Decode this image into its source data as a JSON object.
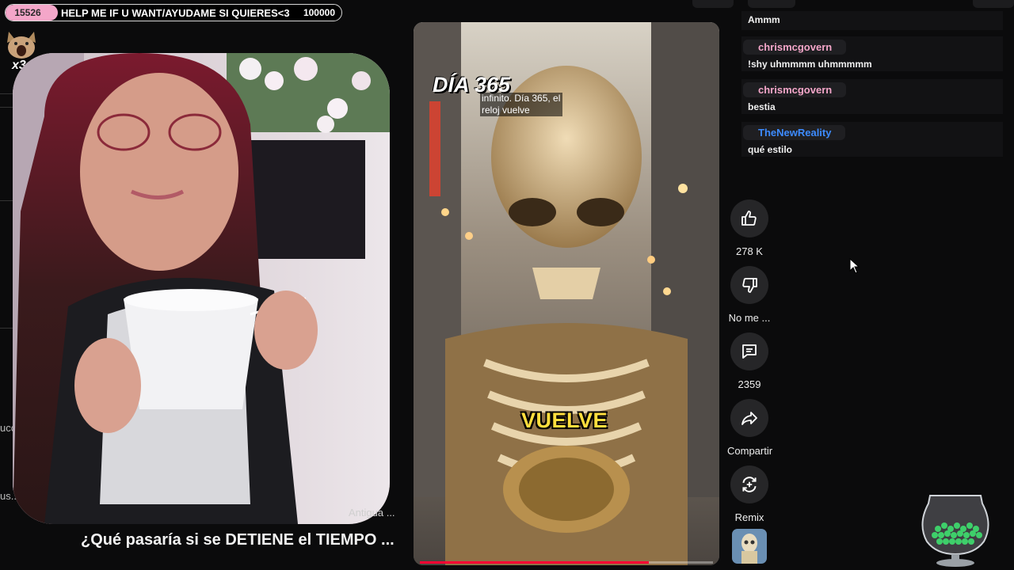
{
  "goal": {
    "current": "15526",
    "text": "HELP ME IF U WANT/AYUDAME SI QUIERES<3",
    "target": "100000",
    "progress_fraction": 0.155,
    "fill_color": "#f4a6c9"
  },
  "emote": {
    "icon": "cat-emote-icon",
    "multiplier": "x3"
  },
  "left_edge": {
    "label_1": "ucc",
    "label_2": "us..."
  },
  "stream": {
    "antigua_label": "Antigua ...",
    "video_title": "¿Qué pasaría si se DETIENE el TIEMPO ..."
  },
  "short": {
    "day_label": "DÍA 365",
    "caption_small": "infinito. Día 365, el reloj vuelve",
    "word_overlay": "VUELVE",
    "progress_fraction": 0.78
  },
  "actions": {
    "like_count": "278 K",
    "dislike_label": "No me ...",
    "comment_count": "2359",
    "share_label": "Compartir",
    "remix_label": "Remix"
  },
  "chat": {
    "first_message": "Ammm",
    "messages": [
      {
        "user": "chrismcgovern",
        "user_color": "#f4a6c9",
        "text": "!shy uhmmmm uhmmmmm"
      },
      {
        "user": "chrismcgovern",
        "user_color": "#f4a6c9",
        "text": "bestia"
      },
      {
        "user": "TheNewReality",
        "user_color": "#3d8bff",
        "text": "qué estilo"
      }
    ]
  }
}
